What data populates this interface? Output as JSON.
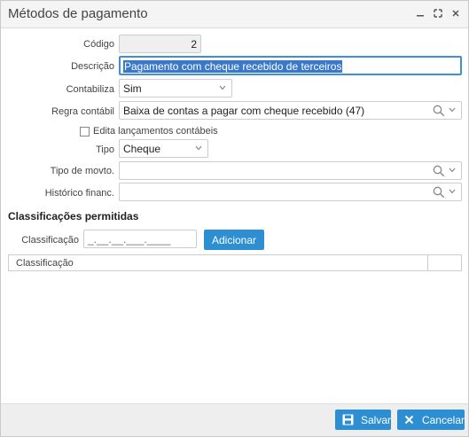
{
  "window": {
    "title": "Métodos de pagamento"
  },
  "form": {
    "codigo": {
      "label": "Código",
      "value": "2"
    },
    "descricao": {
      "label": "Descrição",
      "value": "Pagamento com cheque recebido de terceiros"
    },
    "contabiliza": {
      "label": "Contabiliza",
      "value": "Sim"
    },
    "regra_contabil": {
      "label": "Regra contábil",
      "value": "Baixa de contas a pagar com cheque recebido (47)"
    },
    "edita_lancamentos": {
      "label": "Edita lançamentos contábeis",
      "checked": false
    },
    "tipo": {
      "label": "Tipo",
      "value": "Cheque"
    },
    "tipo_movto": {
      "label": "Tipo de movto.",
      "value": ""
    },
    "historico": {
      "label": "Histórico financ.",
      "value": ""
    }
  },
  "classificacoes": {
    "section_title": "Classificações permitidas",
    "input_label": "Classificação",
    "input_placeholder": "_.__.__.___.____",
    "add_button": "Adicionar",
    "grid_header": "Classificação"
  },
  "footer": {
    "save_label": "Salvar",
    "cancel_label": "Cancelar"
  },
  "colors": {
    "accent": "#2e8ed2",
    "focus_border": "#3d8fd6",
    "selection": "#3b78c8"
  }
}
